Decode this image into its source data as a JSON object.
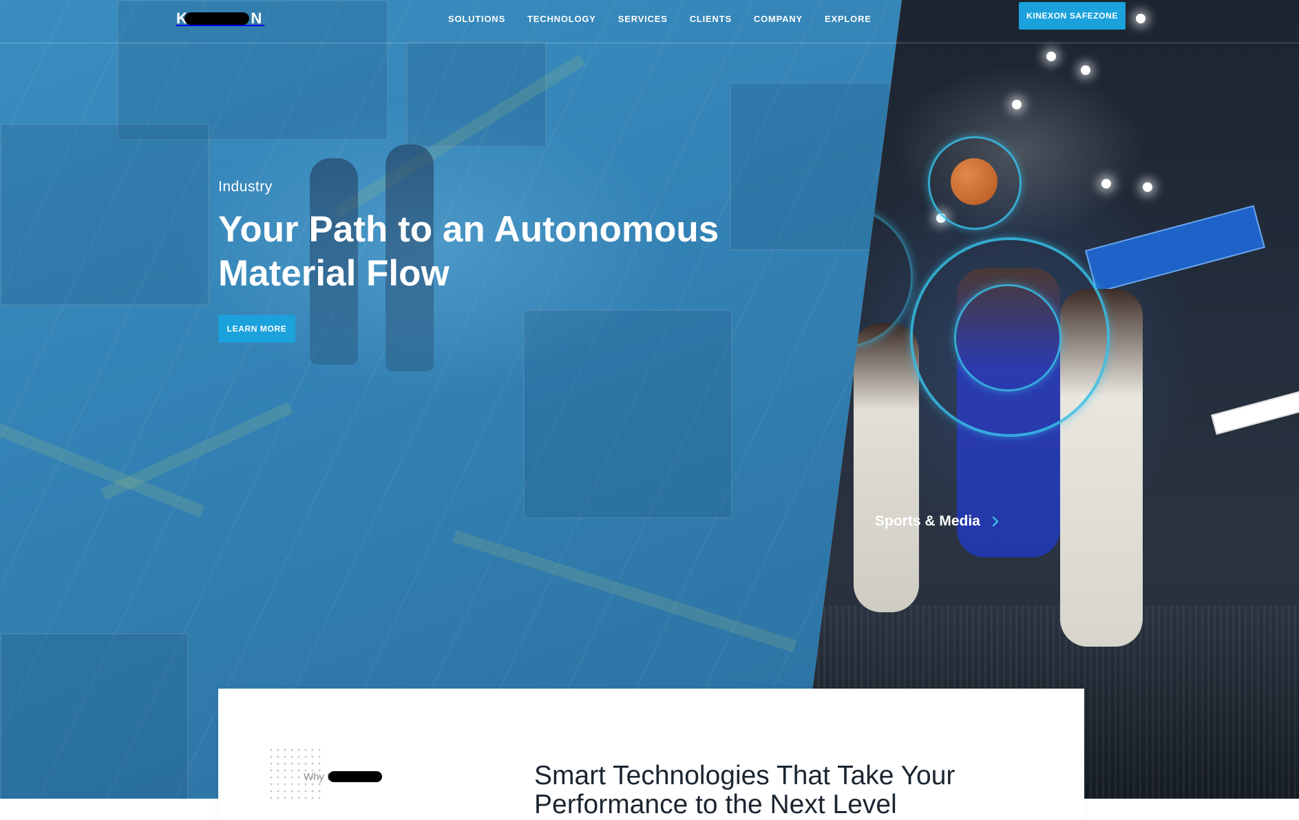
{
  "brand": {
    "logo_text": "KINEXON"
  },
  "nav": {
    "items": [
      {
        "label": "SOLUTIONS"
      },
      {
        "label": "TECHNOLOGY"
      },
      {
        "label": "SERVICES"
      },
      {
        "label": "CLIENTS"
      },
      {
        "label": "COMPANY"
      },
      {
        "label": "EXPLORE"
      }
    ],
    "cta_label": "KINEXON SAFEZONE"
  },
  "hero": {
    "eyebrow": "Industry",
    "headline_line1": "Your Path to an Autonomous",
    "headline_line2": "Material Flow",
    "button_label": "LEARN MORE",
    "secondary_link_label": "Sports & Media",
    "secondary_link_icon": "chevron-right-icon"
  },
  "why_section": {
    "label": "Why KINEXON",
    "heading_line1": "Smart Technologies That Take Your",
    "heading_line2": "Performance to the Next Level"
  },
  "colors": {
    "accent": "#1ba1dc",
    "industry_overlay": "#3483b6",
    "ring": "#37bee6",
    "text_dark": "#1b2530"
  }
}
